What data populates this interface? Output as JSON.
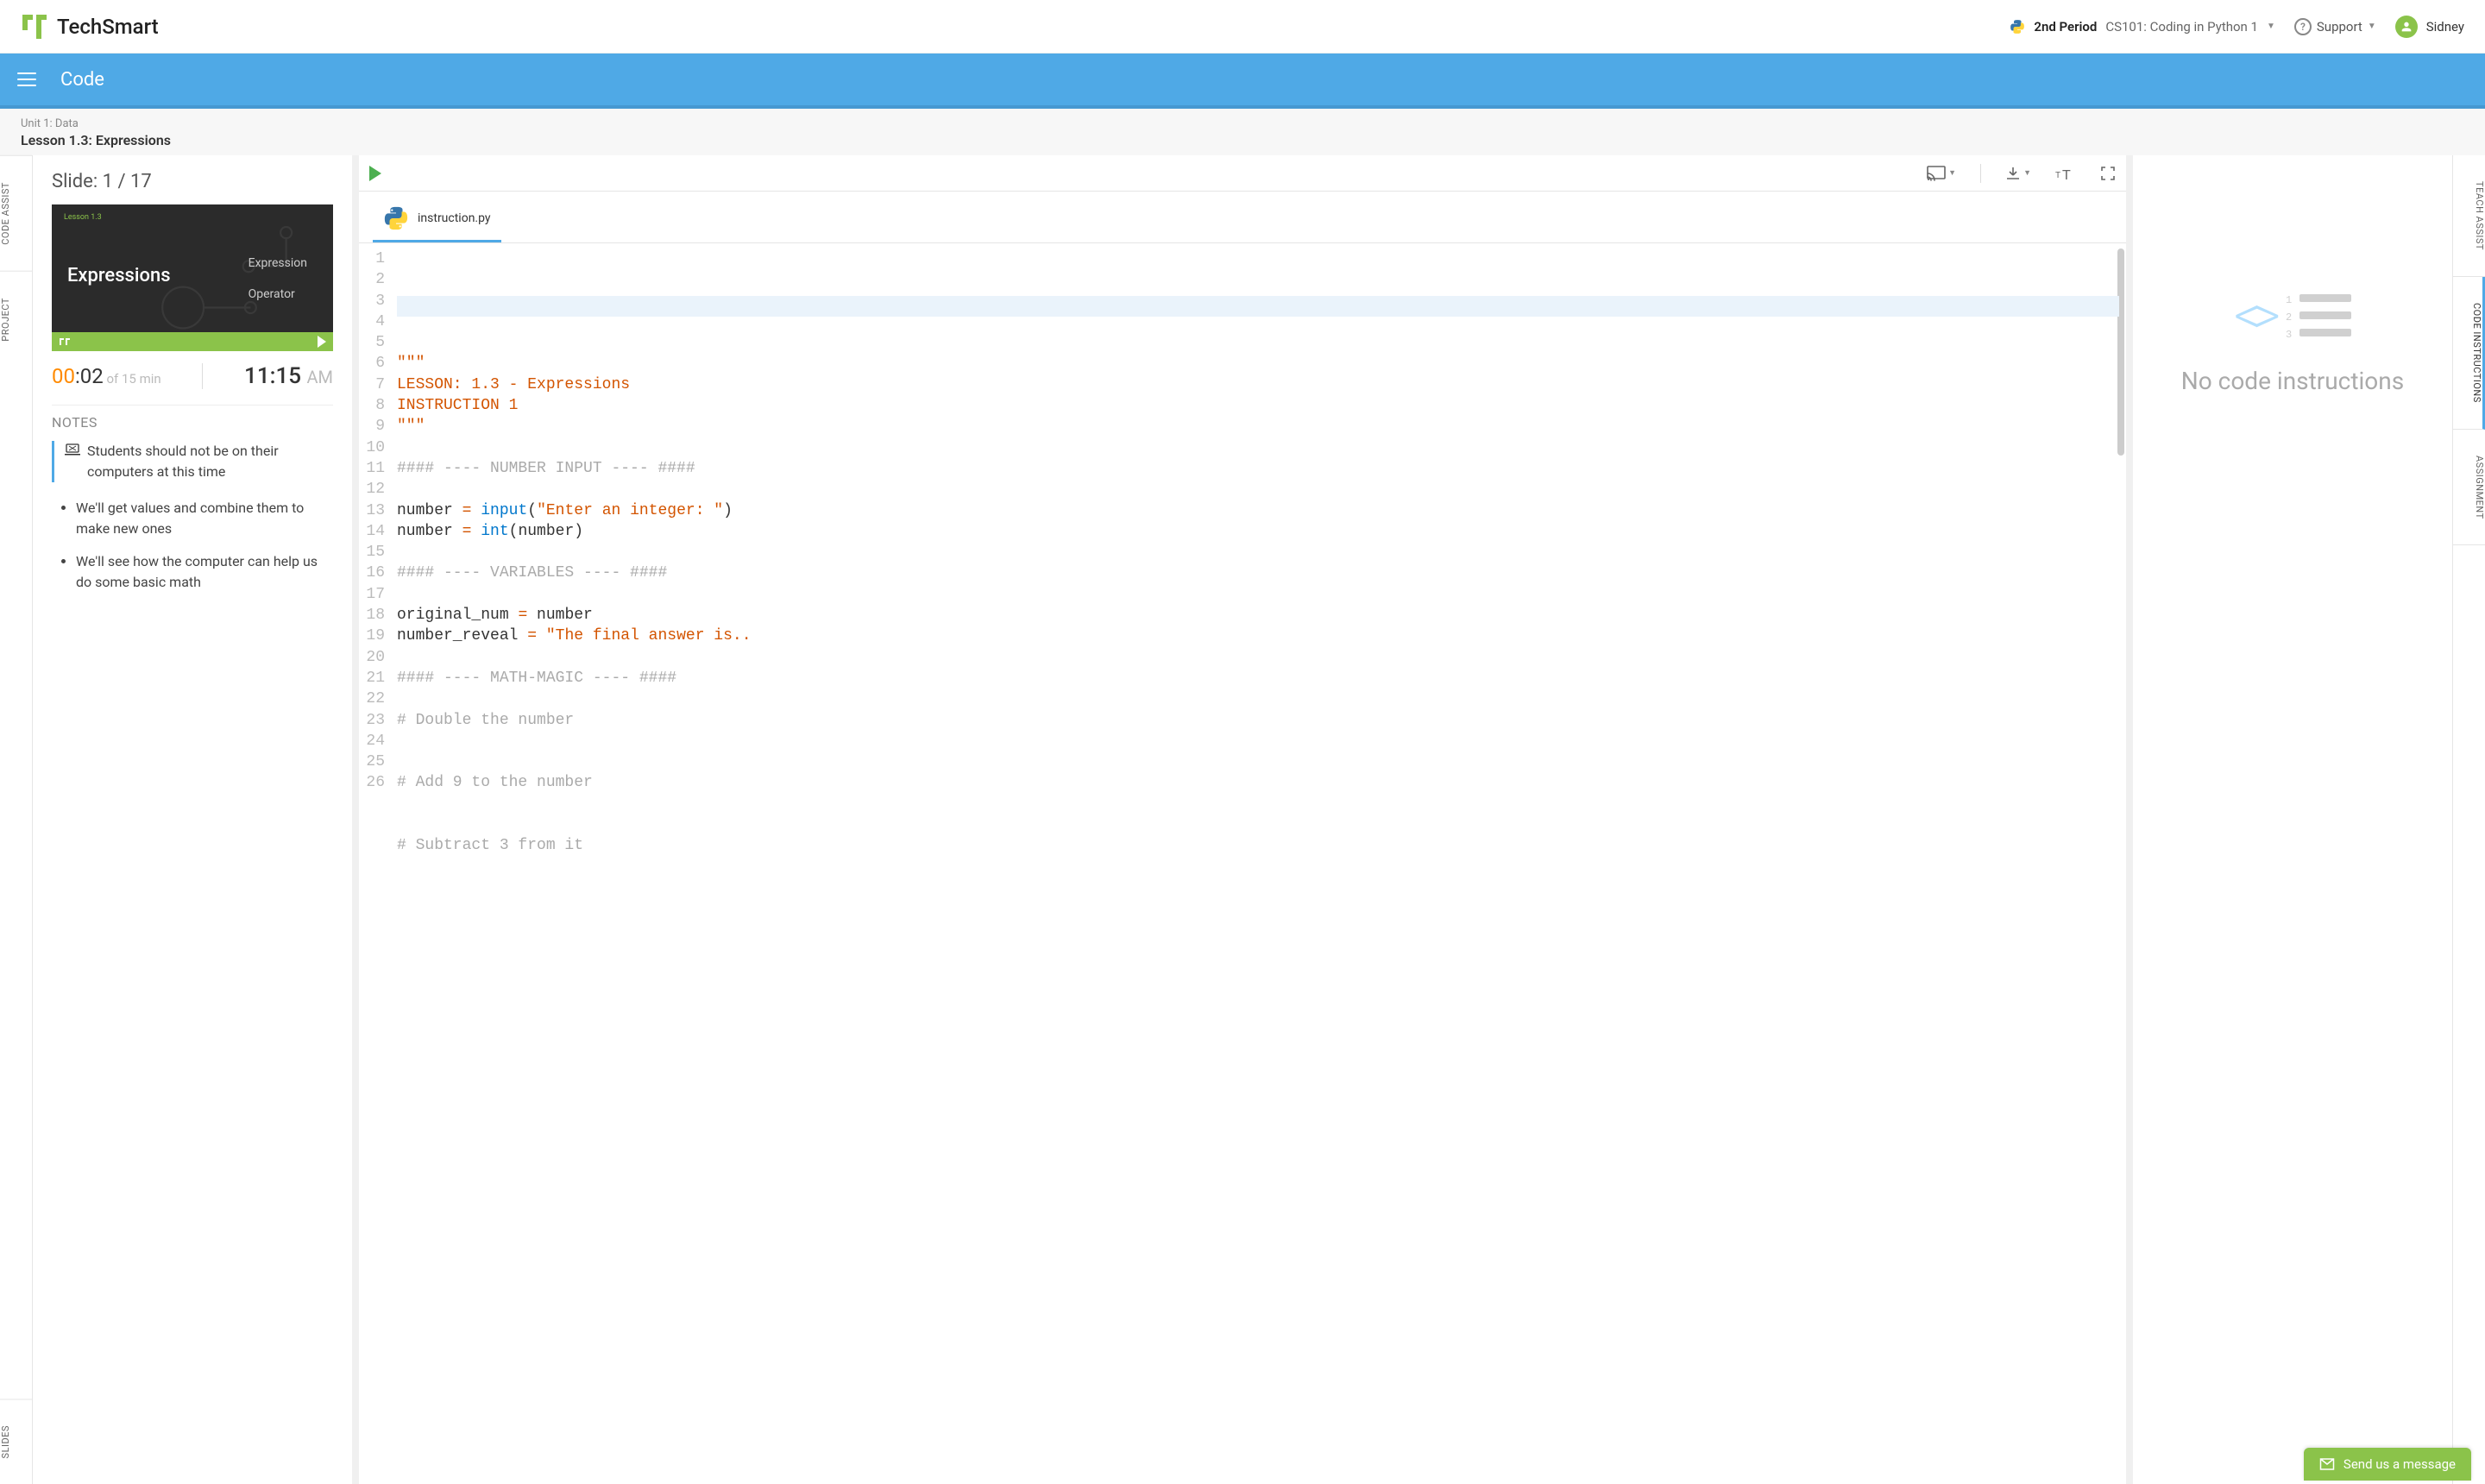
{
  "brand": "TechSmart",
  "header": {
    "period": "2nd Period",
    "course": "CS101: Coding in Python 1",
    "support": "Support",
    "user": "Sidney"
  },
  "bluebar": {
    "title": "Code"
  },
  "breadcrumb": {
    "unit": "Unit 1: Data",
    "lesson": "Lesson 1.3: Expressions"
  },
  "left_tabs": [
    "CODE ASSIST",
    "PROJECT",
    "SLIDES"
  ],
  "slide": {
    "counter": "Slide: 1 / 17",
    "thumb_label": "Lesson 1.3",
    "thumb_title": "Expressions",
    "thumb_items": [
      "Expression",
      "Operator"
    ],
    "elapsed_mm": "00",
    "elapsed_ss": ":02",
    "of_text": " of 15 min",
    "clock": "11:15",
    "ampm": "AM",
    "notes_heading": "NOTES",
    "note_main": "Students should not be on their computers at this time",
    "note_bullets": [
      "We'll get values and combine them to make new ones",
      "We'll see how the computer can help us do some basic math"
    ]
  },
  "editor": {
    "filename": "instruction.py",
    "lines": [
      {
        "n": 1,
        "seg": [
          {
            "t": "\"\"\"",
            "c": "tok-str"
          }
        ]
      },
      {
        "n": 2,
        "seg": [
          {
            "t": "LESSON: 1.3 - Expressions",
            "c": "tok-str"
          }
        ]
      },
      {
        "n": 3,
        "seg": [
          {
            "t": "INSTRUCTION 1",
            "c": "tok-str"
          }
        ]
      },
      {
        "n": 4,
        "seg": [
          {
            "t": "\"\"\"",
            "c": "tok-str"
          }
        ]
      },
      {
        "n": 5,
        "seg": []
      },
      {
        "n": 6,
        "seg": [
          {
            "t": "#### ---- NUMBER INPUT ---- ####",
            "c": "tok-cm"
          }
        ]
      },
      {
        "n": 7,
        "seg": []
      },
      {
        "n": 8,
        "seg": [
          {
            "t": "number ",
            "c": ""
          },
          {
            "t": "=",
            "c": "tok-op"
          },
          {
            "t": " ",
            "c": ""
          },
          {
            "t": "input",
            "c": "tok-kw"
          },
          {
            "t": "(",
            "c": ""
          },
          {
            "t": "\"Enter an integer: \"",
            "c": "tok-str"
          },
          {
            "t": ")",
            "c": ""
          }
        ]
      },
      {
        "n": 9,
        "seg": [
          {
            "t": "number ",
            "c": ""
          },
          {
            "t": "=",
            "c": "tok-op"
          },
          {
            "t": " ",
            "c": ""
          },
          {
            "t": "int",
            "c": "tok-kw"
          },
          {
            "t": "(number)",
            "c": ""
          }
        ]
      },
      {
        "n": 10,
        "seg": []
      },
      {
        "n": 11,
        "seg": [
          {
            "t": "#### ---- VARIABLES ---- ####",
            "c": "tok-cm"
          }
        ]
      },
      {
        "n": 12,
        "seg": []
      },
      {
        "n": 13,
        "seg": [
          {
            "t": "original_num ",
            "c": ""
          },
          {
            "t": "=",
            "c": "tok-op"
          },
          {
            "t": " number",
            "c": ""
          }
        ]
      },
      {
        "n": 14,
        "seg": [
          {
            "t": "number_reveal ",
            "c": ""
          },
          {
            "t": "=",
            "c": "tok-op"
          },
          {
            "t": " ",
            "c": ""
          },
          {
            "t": "\"The final answer is..",
            "c": "tok-str"
          }
        ]
      },
      {
        "n": 15,
        "seg": []
      },
      {
        "n": 16,
        "seg": [
          {
            "t": "#### ---- MATH-MAGIC ---- ####",
            "c": "tok-cm"
          }
        ]
      },
      {
        "n": 17,
        "seg": []
      },
      {
        "n": 18,
        "seg": [
          {
            "t": "# Double the number",
            "c": "tok-cm"
          }
        ]
      },
      {
        "n": 19,
        "seg": []
      },
      {
        "n": 20,
        "seg": []
      },
      {
        "n": 21,
        "seg": [
          {
            "t": "# Add 9 to the number",
            "c": "tok-cm"
          }
        ]
      },
      {
        "n": 22,
        "seg": []
      },
      {
        "n": 23,
        "seg": []
      },
      {
        "n": 24,
        "seg": [
          {
            "t": "# Subtract 3 from it",
            "c": "tok-cm"
          }
        ]
      },
      {
        "n": 25,
        "seg": []
      },
      {
        "n": 26,
        "seg": []
      }
    ]
  },
  "right_panel": {
    "empty_text": "No code instructions"
  },
  "right_tabs": [
    "TEACH ASSIST",
    "CODE INSTRUCTIONS",
    "ASSIGNMENT"
  ],
  "chat": {
    "label": "Send us a message"
  }
}
